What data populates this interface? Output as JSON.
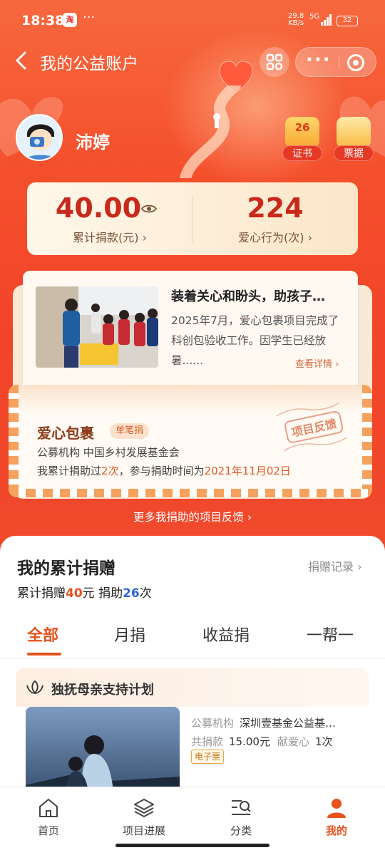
{
  "status_bar": {
    "time": "18:38",
    "net_speed": "29.8",
    "net_unit": "KB/s",
    "signal": "5G",
    "battery": "32"
  },
  "nav": {
    "title": "我的公益账户"
  },
  "profile": {
    "name": "沛婷",
    "certificate": {
      "count": "26",
      "label": "证书"
    },
    "receipt": {
      "label": "票据"
    }
  },
  "stats": {
    "donation_total": "40.00",
    "donation_label": "累计捐款(元) ›",
    "actions_total": "224",
    "actions_label": "爱心行为(次) ›"
  },
  "feedback": {
    "news_title": "装着关心和盼头，助孩子…",
    "news_body": "2025年7月，爱心包裹项目完成了科创包验收工作。因学生已经放暑......",
    "news_more": "查看详情 ›",
    "project_name": "爱心包裹",
    "project_tag": "单笔捐",
    "org_label": "公募机构",
    "org_name": "中国乡村发展基金会",
    "line_prefix": "我累计捐助过",
    "times": "2次",
    "line_mid": "，参与捐助时间为",
    "date": "2021年11月02日",
    "stamp": "项目反馈",
    "more_link": "更多我捐助的项目反馈 ›"
  },
  "donations": {
    "title": "我的累计捐赠",
    "records_link": "捐赠记录 ›",
    "summary_prefix": "累计捐赠",
    "amount": "40",
    "summary_unit": "元 捐助",
    "count": "26",
    "count_unit": "次",
    "tabs": [
      "全部",
      "月捐",
      "收益捐",
      "一帮一"
    ],
    "active_tab": "全部"
  },
  "project_card": {
    "title": "独抚母亲支持计划",
    "org_key": "公募机构",
    "org_value": "深圳壹基金公益基…",
    "total_key": "共捐款",
    "total_value": "15.00元",
    "love_key": "献爱心",
    "love_value": "1次",
    "ticket_tag": "电子票"
  },
  "tabbar": {
    "items": [
      {
        "label": "首页",
        "icon": "home-icon"
      },
      {
        "label": "项目进展",
        "icon": "layers-icon"
      },
      {
        "label": "分类",
        "icon": "category-search-icon"
      },
      {
        "label": "我的",
        "icon": "person-icon"
      }
    ],
    "active": "我的"
  },
  "colors": {
    "accent": "#e8521c",
    "hero": "#f4502c",
    "link_blue": "#2f66d6"
  }
}
